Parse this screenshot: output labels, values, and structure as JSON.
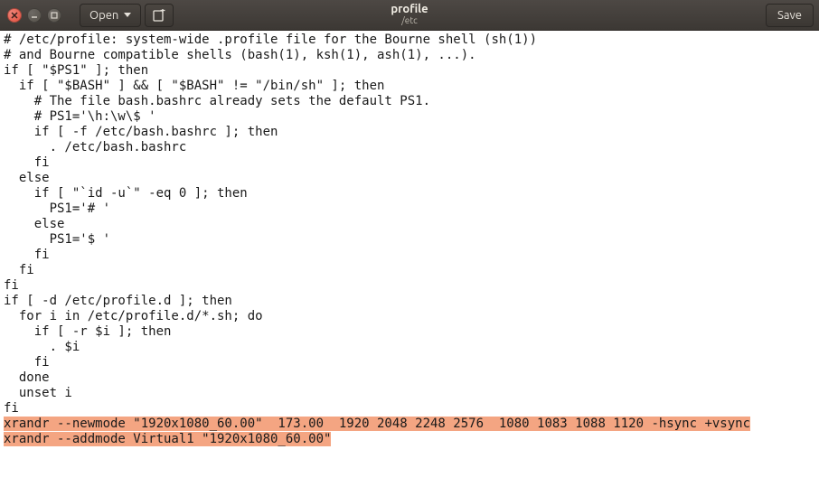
{
  "window": {
    "title": "profile",
    "subtitle": "/etc"
  },
  "toolbar": {
    "open_label": "Open",
    "save_label": "Save"
  },
  "editor": {
    "plain_lines": [
      "# /etc/profile: system-wide .profile file for the Bourne shell (sh(1))",
      "# and Bourne compatible shells (bash(1), ksh(1), ash(1), ...).",
      "",
      "if [ \"$PS1\" ]; then",
      "  if [ \"$BASH\" ] && [ \"$BASH\" != \"/bin/sh\" ]; then",
      "    # The file bash.bashrc already sets the default PS1.",
      "    # PS1='\\h:\\w\\$ '",
      "    if [ -f /etc/bash.bashrc ]; then",
      "      . /etc/bash.bashrc",
      "    fi",
      "  else",
      "    if [ \"`id -u`\" -eq 0 ]; then",
      "      PS1='# '",
      "    else",
      "      PS1='$ '",
      "    fi",
      "  fi",
      "fi",
      "",
      "if [ -d /etc/profile.d ]; then",
      "  for i in /etc/profile.d/*.sh; do",
      "    if [ -r $i ]; then",
      "      . $i",
      "    fi",
      "  done",
      "  unset i",
      "fi"
    ],
    "highlighted_lines": [
      "xrandr --newmode \"1920x1080_60.00\"  173.00  1920 2048 2248 2576  1080 1083 1088 1120 -hsync +vsync",
      "xrandr --addmode Virtual1 \"1920x1080_60.00\""
    ]
  }
}
